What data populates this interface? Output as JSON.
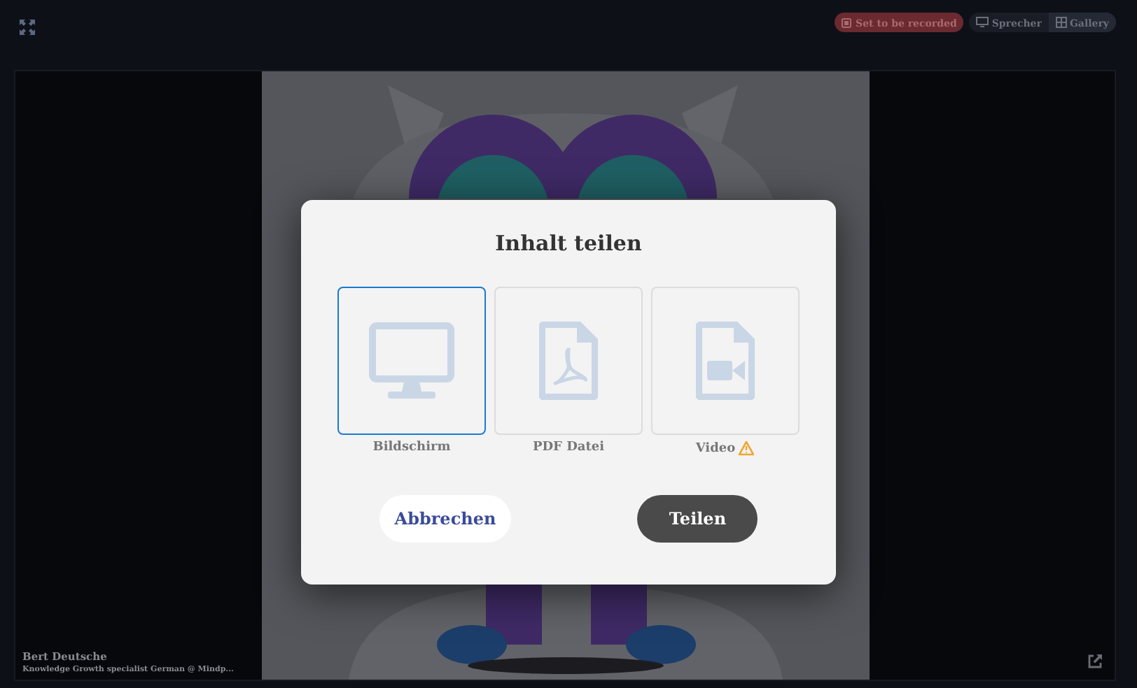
{
  "toolbar": {
    "recording_badge": "Set to be recorded",
    "view_buttons": [
      {
        "label": "Sprecher",
        "kind": "speaker",
        "selected": false
      },
      {
        "label": "Gallery",
        "kind": "gallery",
        "selected": true
      }
    ]
  },
  "participant": {
    "name": "Bert Deutsche",
    "title": "Knowledge Growth specialist German @ Mindp..."
  },
  "dialog": {
    "title": "Inhalt teilen",
    "options": [
      {
        "label": "Bildschirm",
        "kind": "screen",
        "selected": true,
        "warning": false
      },
      {
        "label": "PDF Datei",
        "kind": "pdf",
        "selected": false,
        "warning": false
      },
      {
        "label": "Video",
        "kind": "video",
        "selected": false,
        "warning": true
      }
    ],
    "cancel": "Abbrechen",
    "confirm": "Teilen"
  }
}
